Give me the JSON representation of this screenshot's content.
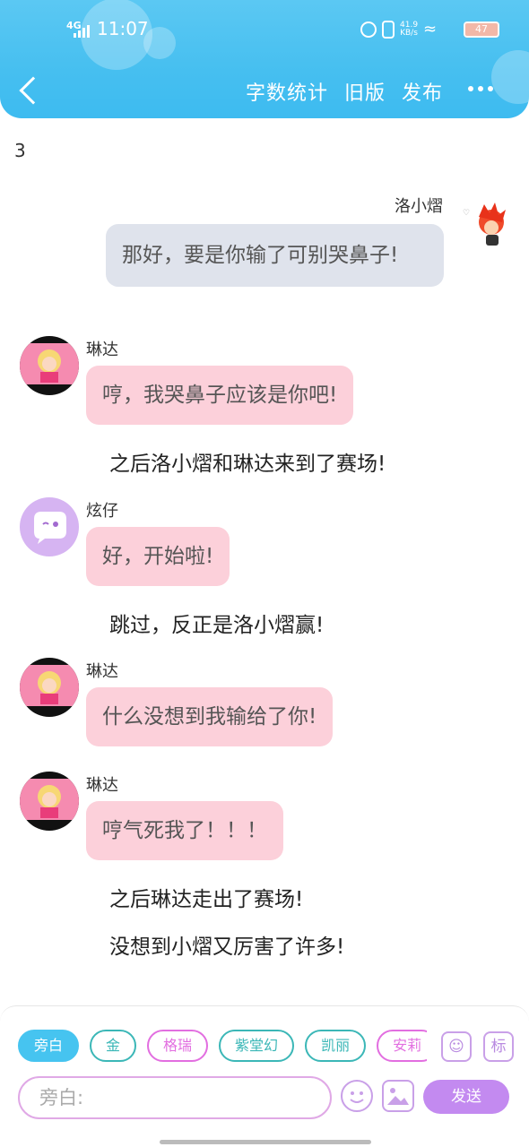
{
  "status": {
    "network": "4G",
    "time": "11:07",
    "netspeed_value": "41.9",
    "netspeed_unit": "KB/s",
    "battery": "47"
  },
  "nav": {
    "word_count": "字数统计",
    "old_version": "旧版",
    "publish": "发布"
  },
  "count": "3",
  "messages": [
    {
      "name": "洛小熠",
      "text": "那好，要是你输了可别哭鼻子!"
    },
    {
      "name": "琳达",
      "text": "哼，我哭鼻子应该是你吧!"
    },
    {
      "narration": "之后洛小熠和琳达来到了赛场!"
    },
    {
      "name": "炫仔",
      "text": "好，开始啦!"
    },
    {
      "narration": "跳过，反正是洛小熠赢!"
    },
    {
      "name": "琳达",
      "text": "什么没想到我输给了你!"
    },
    {
      "name": "琳达",
      "text": "哼气死我了！！！"
    },
    {
      "narration": "之后琳达走出了赛场!"
    },
    {
      "narration": "没想到小熠又厉害了许多!"
    }
  ],
  "chips": [
    "旁白",
    "金",
    "格瑞",
    "紫堂幻",
    "凯丽",
    "安莉"
  ],
  "side_buttons": {
    "mark": "标"
  },
  "input": {
    "placeholder": "旁白:"
  },
  "send": "发送",
  "colors": {
    "header": "#46bff0",
    "pink_bubble": "#fcd0da",
    "gray_bubble": "#dfe3ec",
    "send": "#c38af0"
  }
}
